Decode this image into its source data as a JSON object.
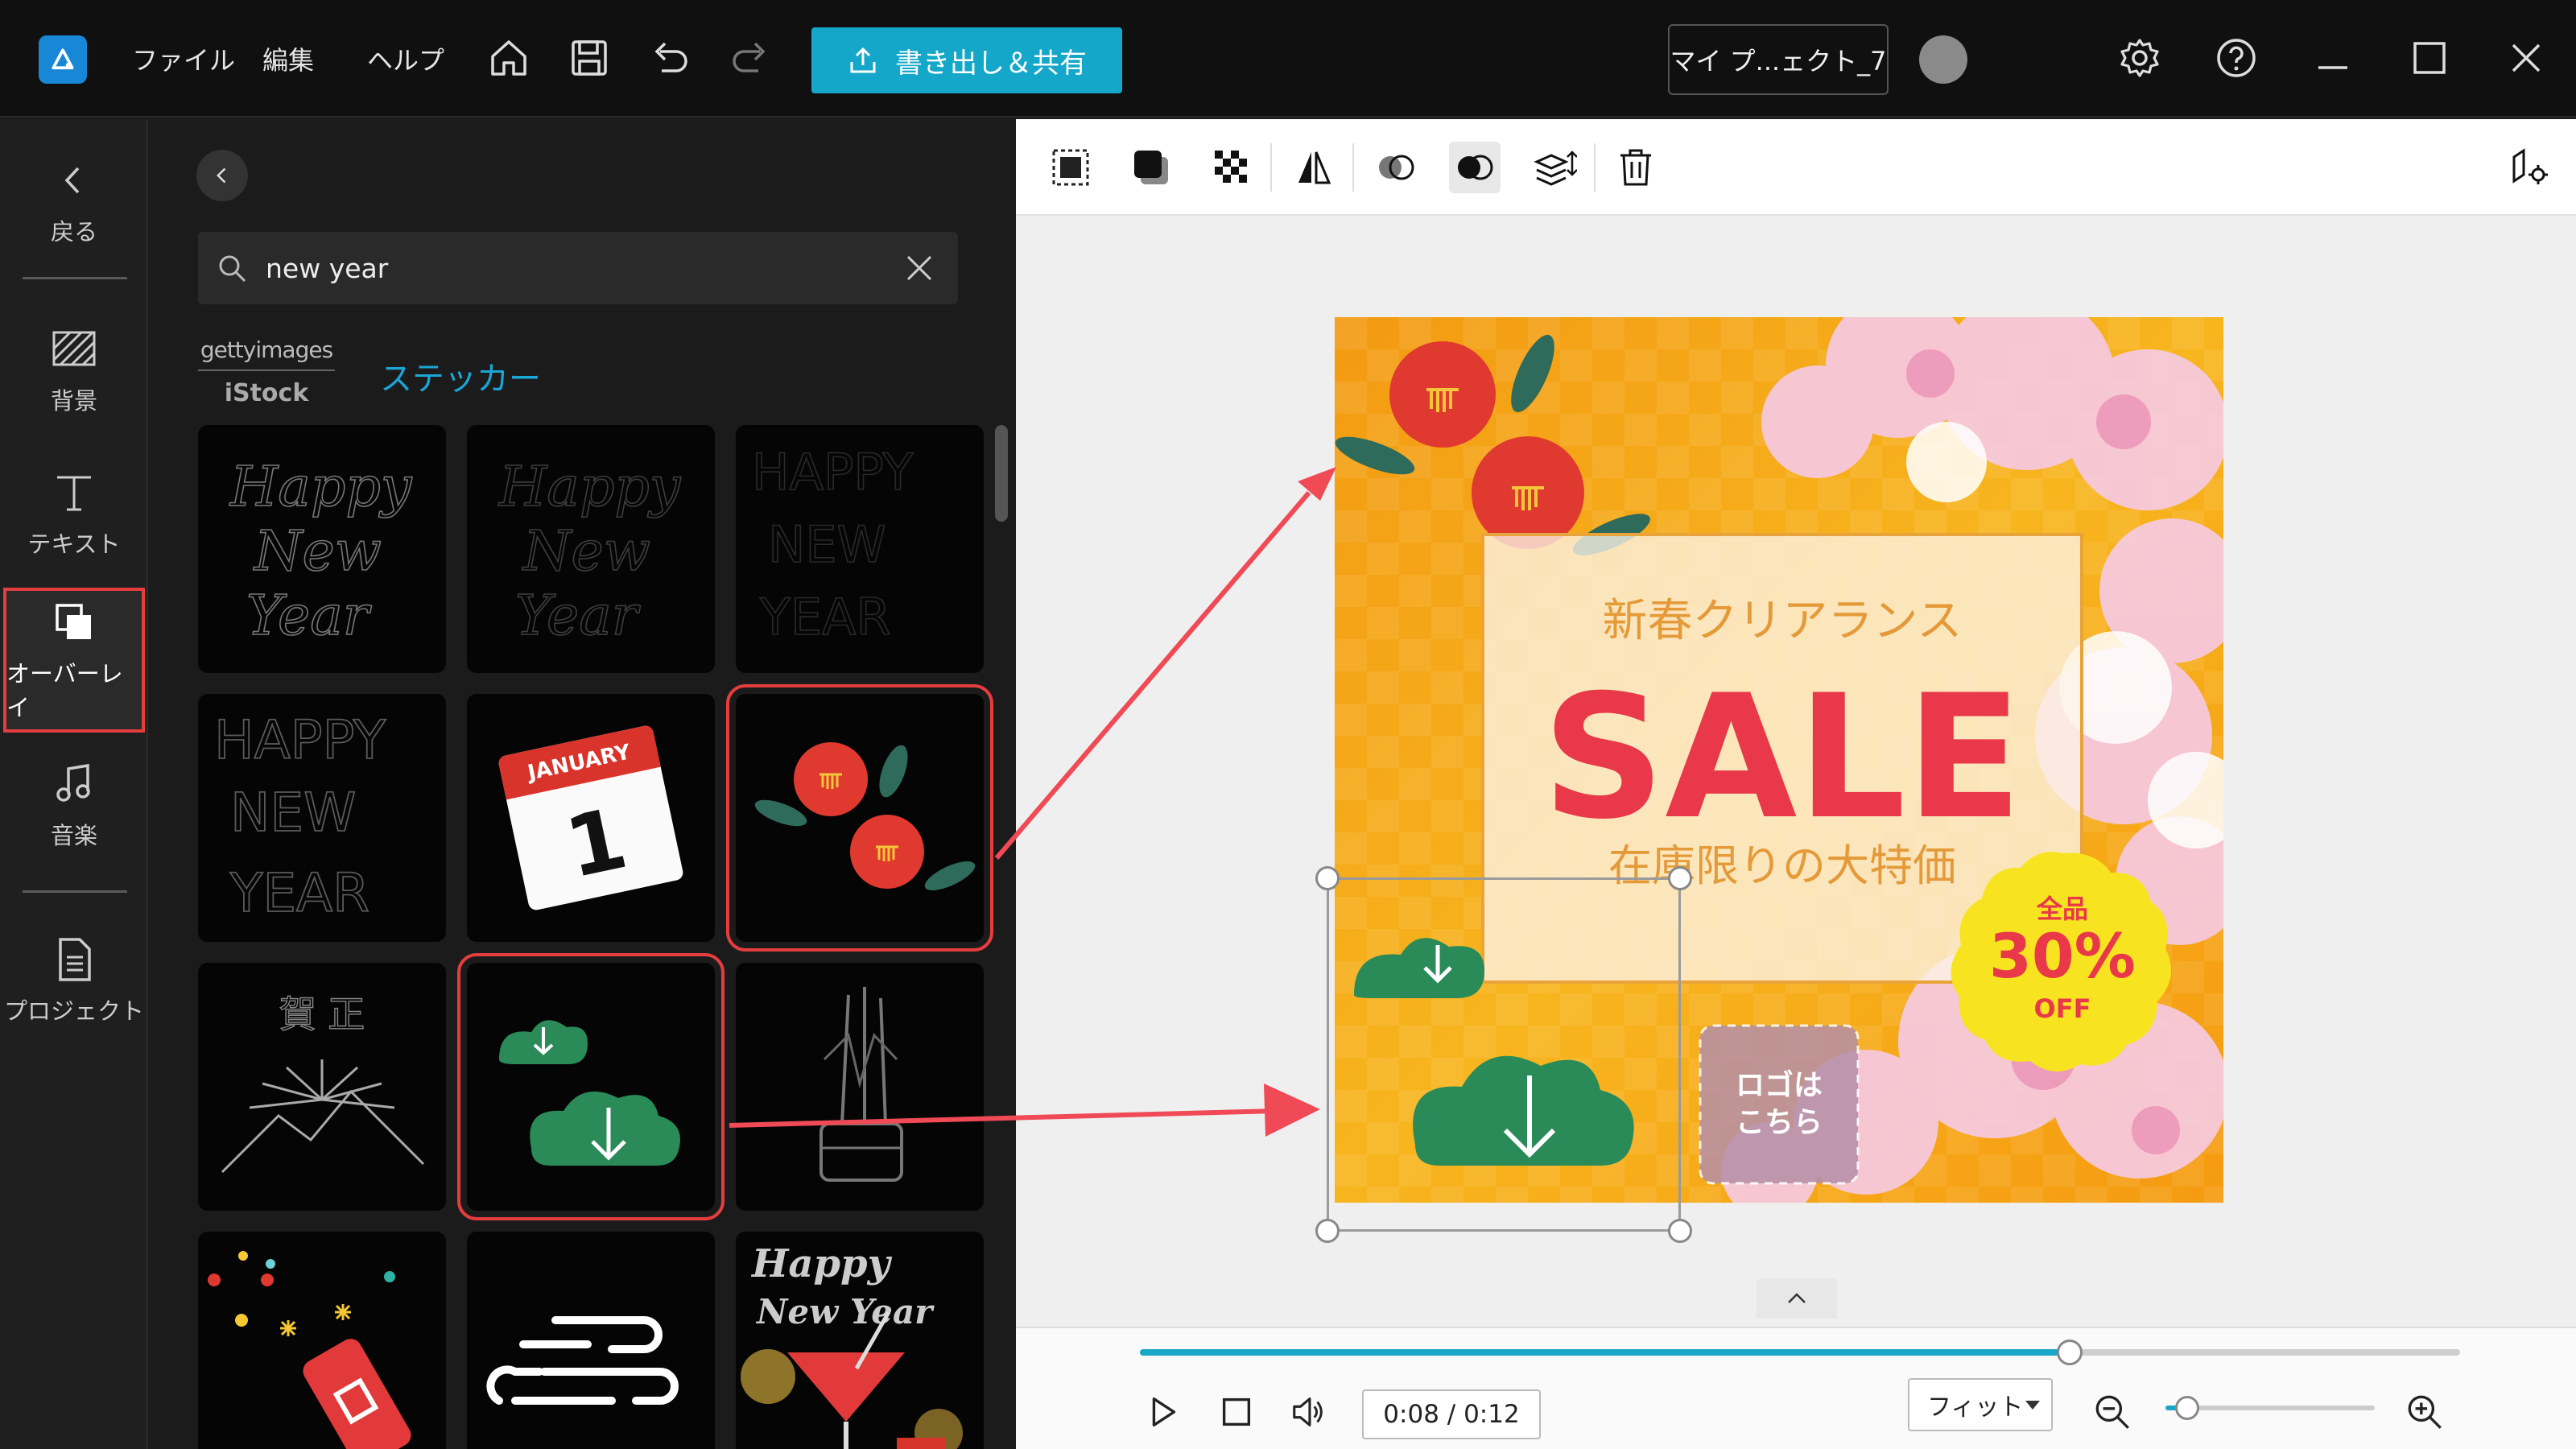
{
  "menu": {
    "file": "ファイル",
    "edit": "編集",
    "help": "ヘルプ"
  },
  "export_label": "書き出し＆共有",
  "project_name": "マイ プ...ェクト_7",
  "nav": {
    "back": "戻る",
    "background": "背景",
    "text": "テキスト",
    "overlay": "オーバーレイ",
    "music": "音楽",
    "project": "プロジェクト"
  },
  "search": {
    "value": "new year",
    "placeholder": "new year"
  },
  "getty": {
    "top": "gettyimages",
    "bottom": "iStock"
  },
  "sticker_tab": "ステッカー",
  "thumbs": {
    "calendar_month": "JANUARY",
    "calendar_day": "1",
    "gasho": "賀 正",
    "hny1": "Happy",
    "hny2": "New Year",
    "script1": "Happy",
    "script2": "New",
    "script3": "Year",
    "block1": "HAPPY",
    "block2": "NEW",
    "block3": "YEAR"
  },
  "canvas": {
    "subtitle": "新春クリアランス",
    "headline": "SALE",
    "tagline": "在庫限りの大特価",
    "badge_top": "全品",
    "badge_main": "30%",
    "badge_bottom": "OFF",
    "logo_line1": "ロゴは",
    "logo_line2": "こちら"
  },
  "playback": {
    "timecode": "0:08 / 0:12",
    "progress": 0.704,
    "zoom_mode": "フィット",
    "zoom": 0.1
  },
  "colors": {
    "accent": "#14a7c9",
    "highlight": "#e53d3d",
    "sale_red": "#e8384a"
  }
}
